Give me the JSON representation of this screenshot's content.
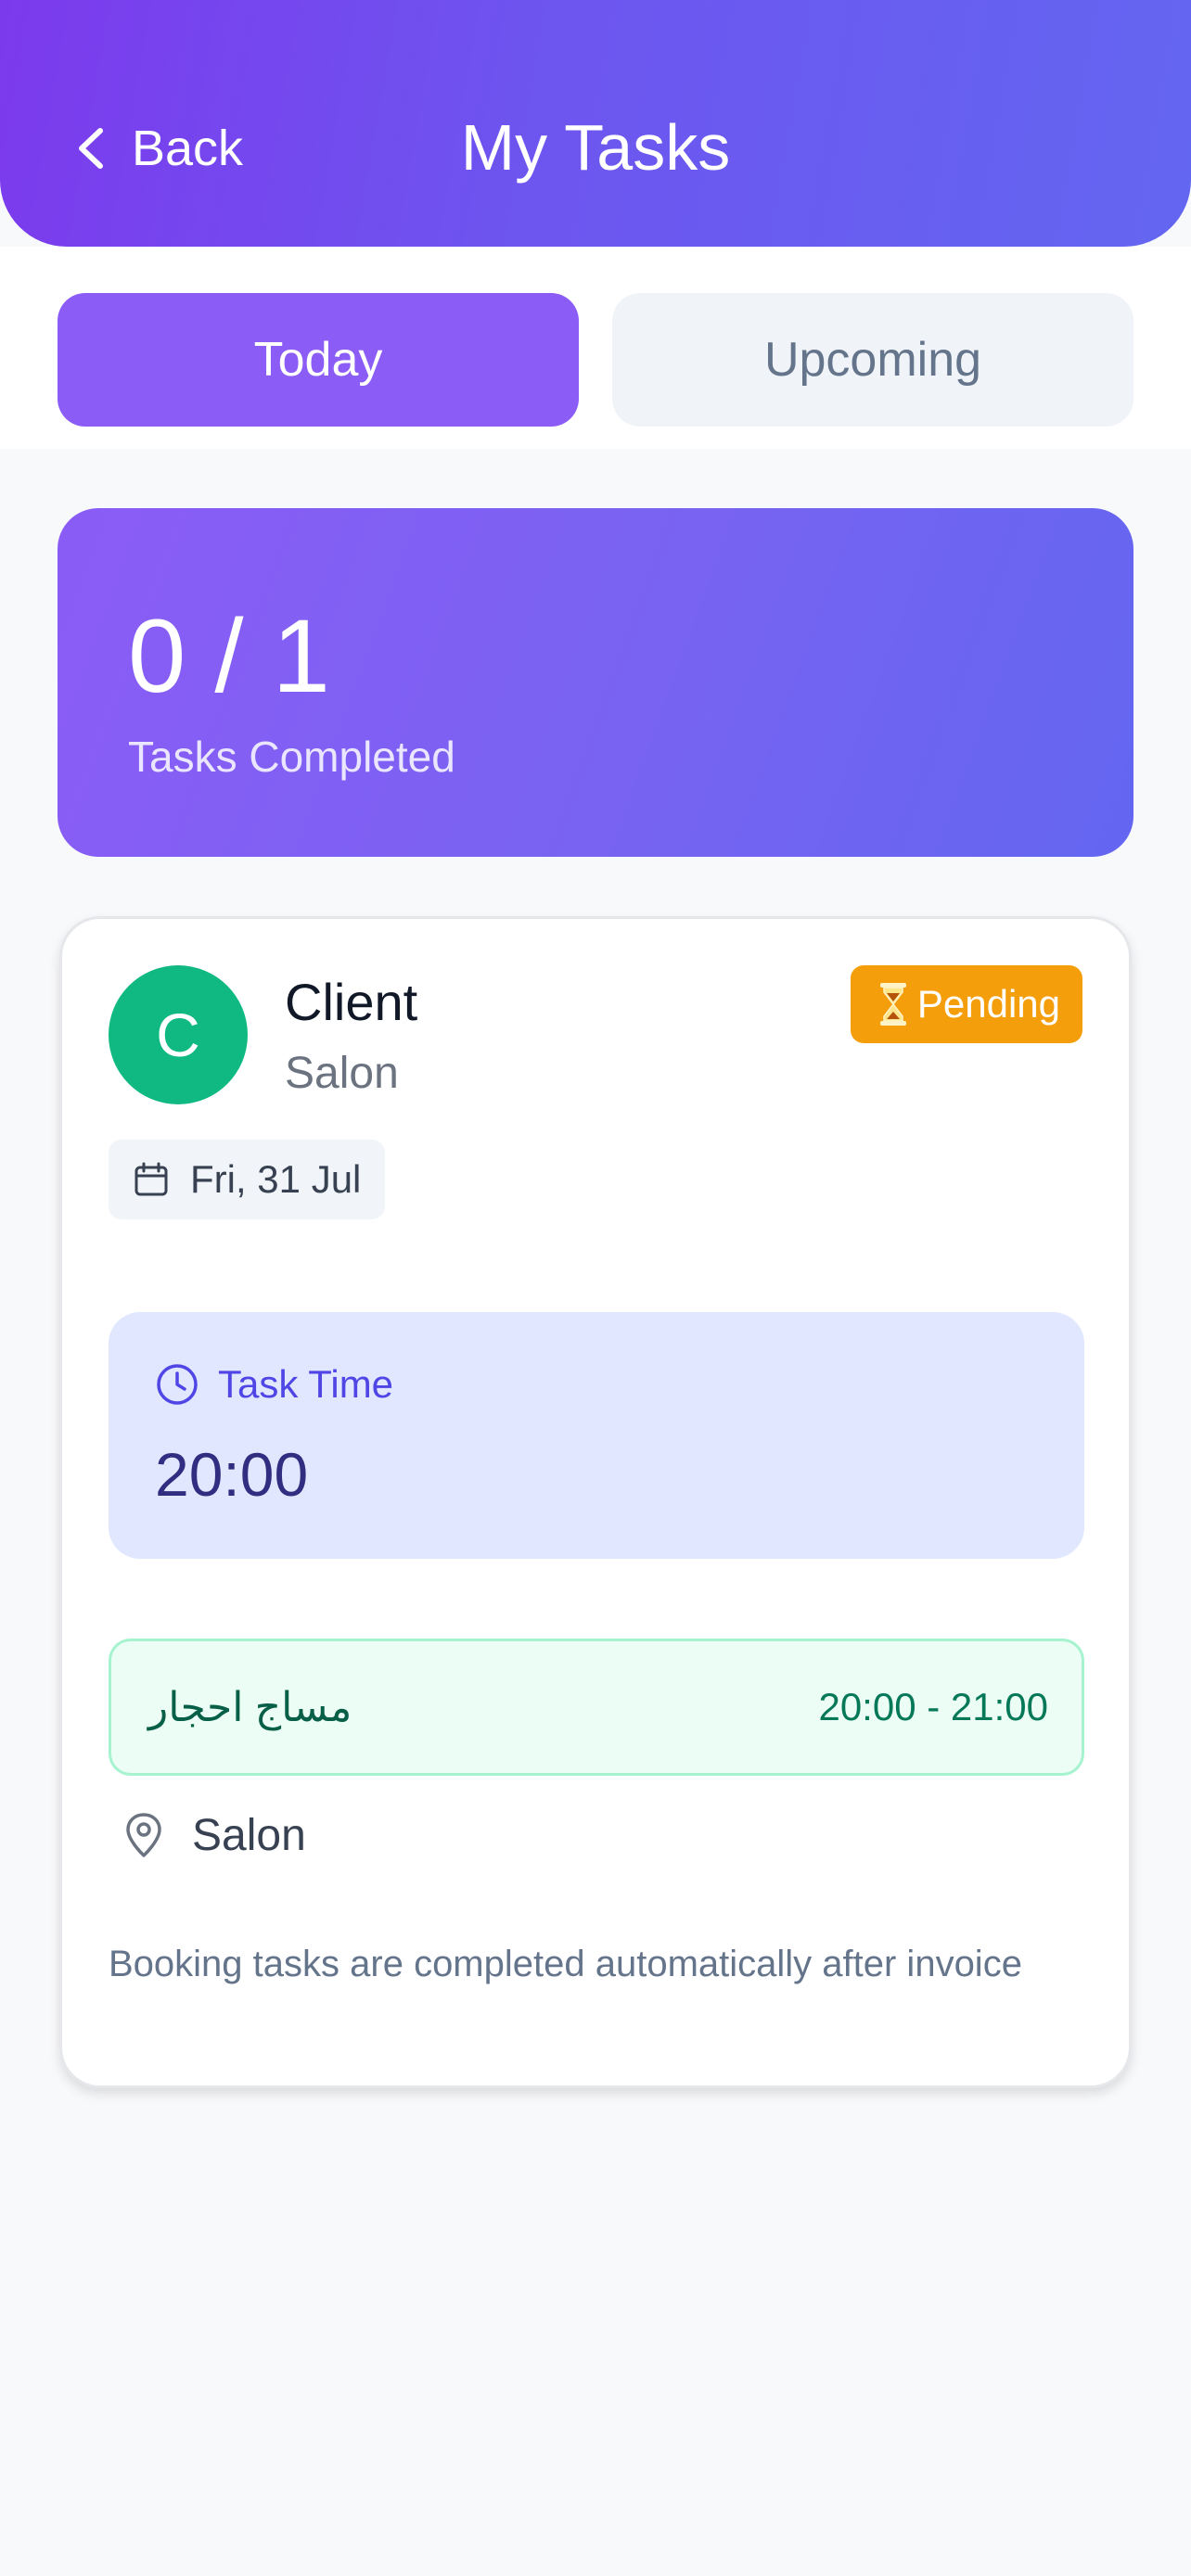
{
  "header": {
    "back_label": "Back",
    "title": "My Tasks"
  },
  "tabs": [
    {
      "label": "Today",
      "active": true
    },
    {
      "label": "Upcoming",
      "active": false
    }
  ],
  "summary": {
    "count": "0 / 1",
    "label": "Tasks Completed"
  },
  "task": {
    "avatar_letter": "C",
    "client_name": "Client",
    "client_subtitle": "Salon",
    "status": "Pending",
    "date": "Fri, 31 Jul",
    "time_label": "Task Time",
    "time_value": "20:00",
    "service_name": "مساج احجار",
    "service_time": "20:00 - 21:00",
    "location": "Salon",
    "note": "Booking tasks are completed automatically after invoice"
  },
  "colors": {
    "header_gradient_start": "#7c3aed",
    "header_gradient_end": "#6366f1",
    "active_tab": "#8b5cf6",
    "avatar": "#10b981",
    "pending": "#f59e0b",
    "time_box": "#e0e7ff",
    "service_box": "#ecfdf5"
  },
  "icons": {
    "back": "chevron-left-icon",
    "status": "hourglass-icon",
    "date": "calendar-icon",
    "time": "clock-icon",
    "location": "map-pin-icon"
  }
}
